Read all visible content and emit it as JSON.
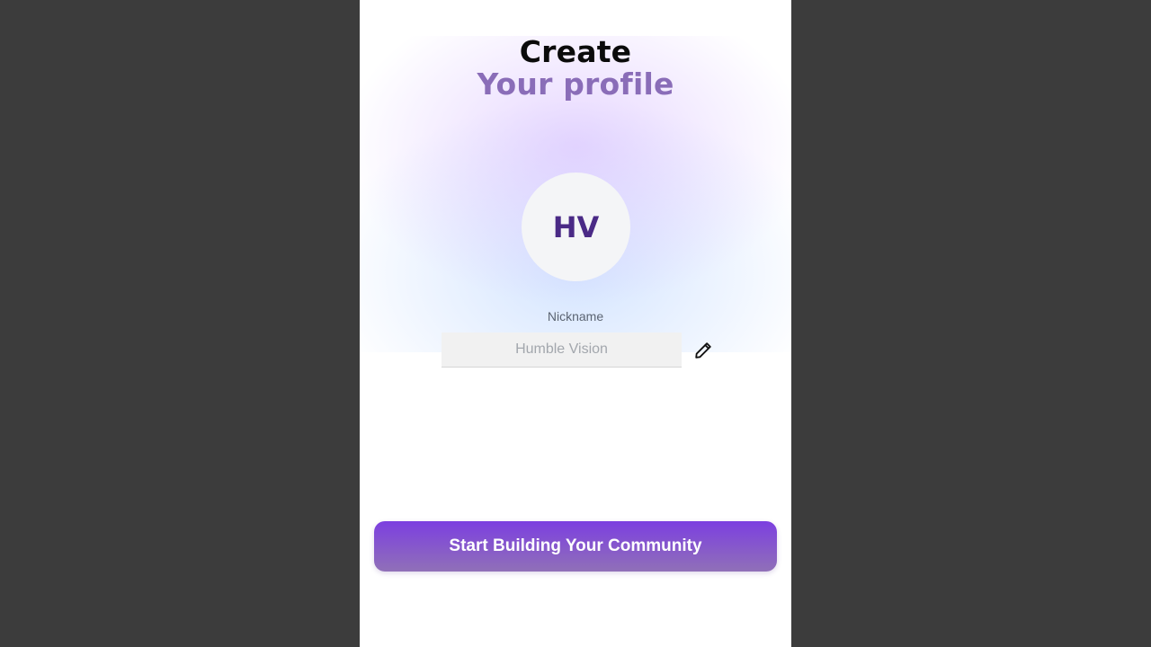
{
  "header": {
    "title_line1": "Create",
    "title_line2": "Your profile"
  },
  "avatar": {
    "initials": "HV"
  },
  "nickname": {
    "label": "Nickname",
    "value": "",
    "placeholder": "Humble Vision",
    "edit_icon": "pencil-icon"
  },
  "cta": {
    "label": "Start Building Your Community"
  },
  "colors": {
    "backdrop": "#3c3c3c",
    "title_primary": "#0b0b0b",
    "title_accent": "#8a6db8",
    "avatar_text": "#4a2a86",
    "cta_gradient_start": "#7c3fe0",
    "cta_gradient_end": "#9070b8"
  }
}
